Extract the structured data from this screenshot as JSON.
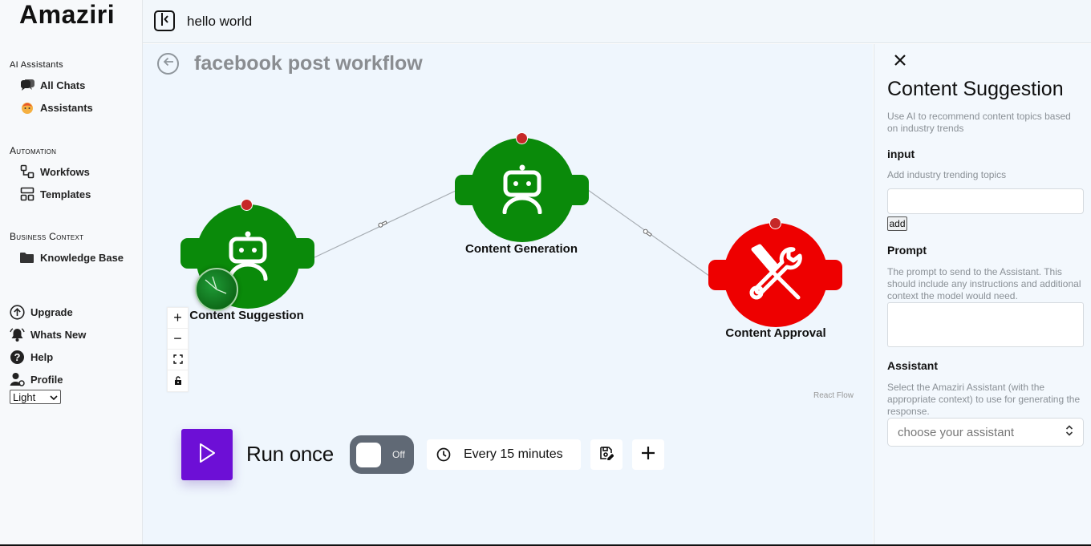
{
  "app": {
    "name": "Amaziri"
  },
  "sidebar": {
    "sections": [
      {
        "title": "AI Assistants"
      },
      {
        "title": "Automation"
      },
      {
        "title": "Business Context"
      }
    ],
    "items": [
      {
        "label": "All Chats",
        "icon": "chat-bubbles-icon"
      },
      {
        "label": "Assistants",
        "icon": "assistant-avatar-icon"
      },
      {
        "label": "Workfows",
        "icon": "workflow-icon"
      },
      {
        "label": "Templates",
        "icon": "templates-icon"
      },
      {
        "label": "Knowledge Base",
        "icon": "folder-icon"
      },
      {
        "label": "Upgrade",
        "icon": "upgrade-arrow-icon"
      },
      {
        "label": "Whats New",
        "icon": "bell-icon"
      },
      {
        "label": "Help",
        "icon": "help-icon"
      },
      {
        "label": "Profile",
        "icon": "profile-icon"
      }
    ],
    "theme": {
      "selected": "Light"
    }
  },
  "topbar": {
    "chat_title": "hello world"
  },
  "workflow": {
    "title": "facebook post workflow",
    "nodes": [
      {
        "label": "Content Suggestion",
        "kind": "assistant",
        "color": "#0a8a0a"
      },
      {
        "label": "Content Generation",
        "kind": "assistant",
        "color": "#0a8a0a"
      },
      {
        "label": "Content Approval",
        "kind": "tool",
        "color": "#ee0000"
      }
    ],
    "attribution": "React Flow",
    "run": {
      "label": "Run once"
    },
    "toggle": {
      "state": "Off"
    },
    "schedule": {
      "label": "Every 15 minutes"
    }
  },
  "panel": {
    "title": "Content Suggestion",
    "description": "Use AI to recommend content topics based on industry trends",
    "input": {
      "label": "input",
      "hint": "Add industry trending topics",
      "add_label": "add"
    },
    "prompt": {
      "label": "Prompt",
      "hint": "The prompt to send to the Assistant. This should include any instructions and additional context the model would need."
    },
    "assistant": {
      "label": "Assistant",
      "hint": "Select the Amaziri Assistant (with the appropriate context) to use for generating the response.",
      "placeholder": "choose your assistant"
    }
  }
}
